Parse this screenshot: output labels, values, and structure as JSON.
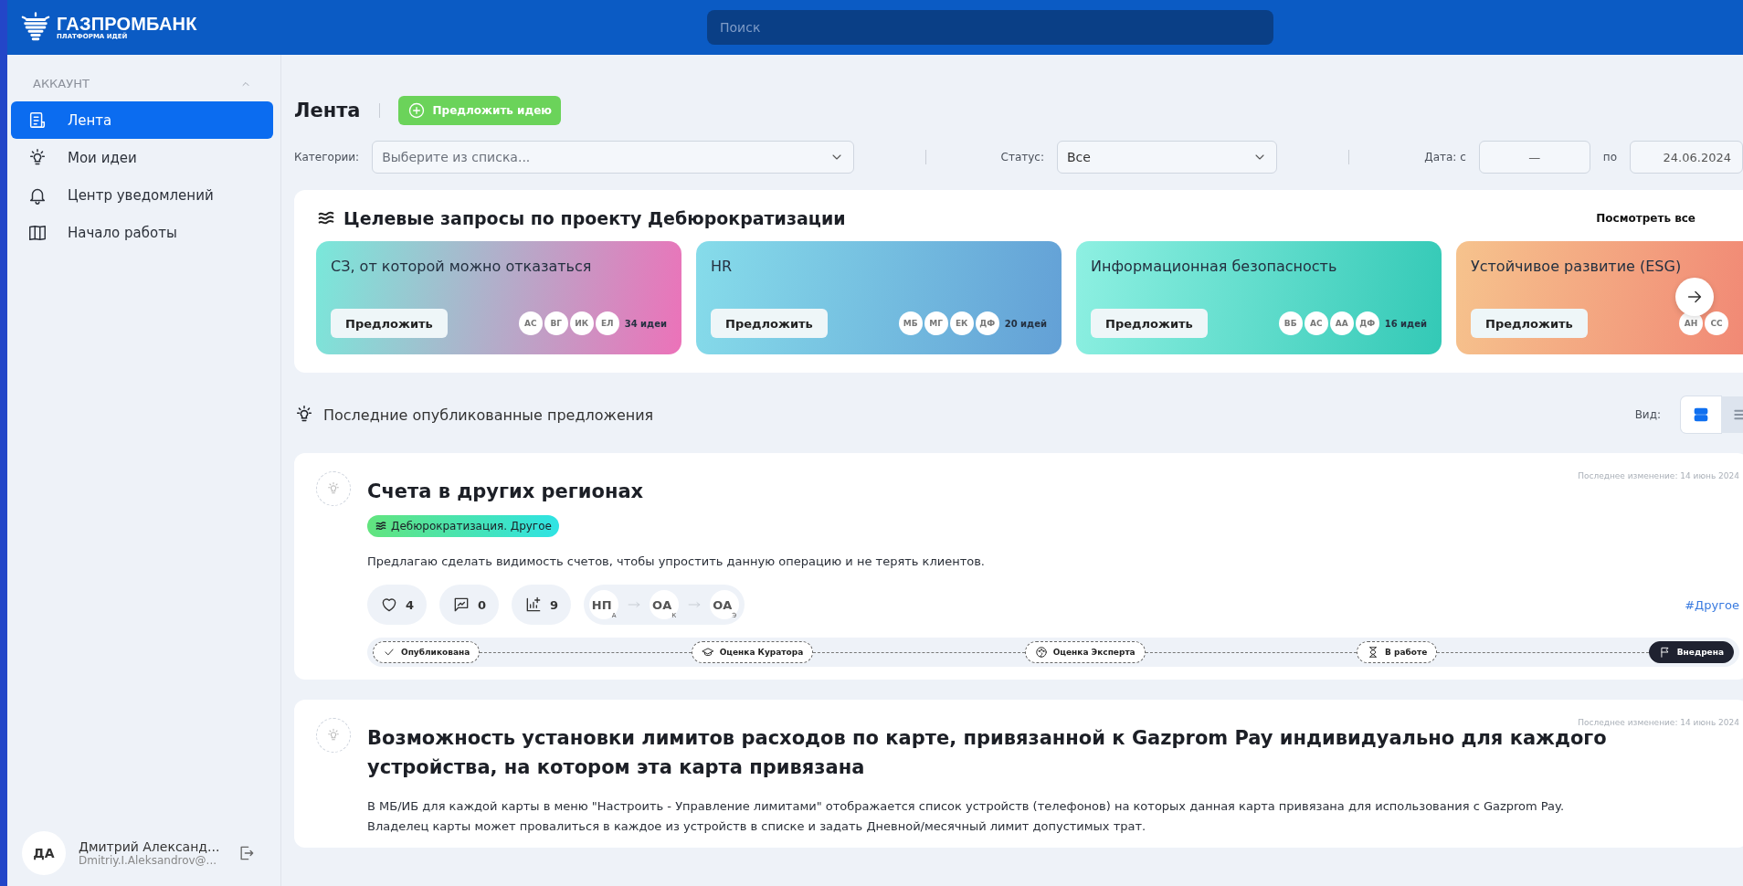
{
  "header": {
    "brand": "ГАЗПРОМБАНК",
    "subtitle": "ПЛАТФОРМА ИДЕЙ",
    "search": {
      "placeholder": "Поиск"
    }
  },
  "sidebar": {
    "section": "АККАУНТ",
    "expanded": true,
    "items": [
      {
        "label": "Лента",
        "selected": true
      },
      {
        "label": "Мои идеи",
        "selected": false
      },
      {
        "label": "Центр уведомлений",
        "selected": false
      },
      {
        "label": "Начало работы",
        "selected": false
      }
    ],
    "user": {
      "initials": "ДА",
      "name": "Дмитрий Александ...",
      "email": "Dmitriy.I.Aleksandrov@..."
    }
  },
  "page": {
    "title": "Лента",
    "propose_button": "Предложить идею",
    "filters": {
      "categories_label": "Категории:",
      "categories_placeholder": "Выберите из списка...",
      "status_label": "Статус:",
      "status_value": "Все",
      "date_label": "Дата: с",
      "date_from": "—",
      "date_to_label": "по",
      "date_to": "24.06.2024"
    }
  },
  "targets": {
    "title": "Целевые запросы по проекту Дебюрократизации",
    "view_all": "Посмотреть все",
    "cards": [
      {
        "title": "СЗ, от которой можно отказаться",
        "button": "Предложить",
        "avatars": [
          "АС",
          "ВГ",
          "ИК",
          "ЕЛ"
        ],
        "count": "34 идеи",
        "color": "#ec72b9"
      },
      {
        "title": "HR",
        "button": "Предложить",
        "avatars": [
          "МБ",
          "МГ",
          "ЕК",
          "ДФ"
        ],
        "count": "20 идей",
        "color": "#63a0d6"
      },
      {
        "title": "Информационная безопасность",
        "button": "Предложить",
        "avatars": [
          "ВБ",
          "АС",
          "АА",
          "ДФ"
        ],
        "count": "16 идей",
        "color": "#33c9b6"
      },
      {
        "title": "Устойчивое развитие (ESG)",
        "button": "Предложить",
        "avatars": [
          "АН",
          "СС"
        ],
        "color": "#f18975"
      }
    ]
  },
  "recent": {
    "title": "Последние опубликованные предложения",
    "view_label": "Вид:",
    "views": [
      {
        "kind": "cards",
        "selected": true
      },
      {
        "kind": "list",
        "selected": false
      }
    ]
  },
  "posts": [
    {
      "title": "Счета в других регионах",
      "date": "Последнее изменение: 14 июнь 2024",
      "tag": "Дебюрократизация. Другое",
      "text": [
        "Предлагаю сделать видимость счетов, чтобы упростить данную операцию и не терять клиентов."
      ],
      "likes": "4",
      "comments": "0",
      "votes": "9",
      "route": [
        {
          "initials": "НП",
          "role": "А"
        },
        {
          "initials": "ОА",
          "role": "К"
        },
        {
          "initials": "ОА",
          "role": "Э"
        }
      ],
      "hashtag": "#Другое",
      "stages": [
        {
          "label": "Опубликована",
          "current": false
        },
        {
          "label": "Оценка Куратора",
          "current": false
        },
        {
          "label": "Оценка Эксперта",
          "current": false
        },
        {
          "label": "В работе",
          "current": false
        },
        {
          "label": "Внедрена",
          "current": true
        }
      ]
    },
    {
      "title": "Возможность установки лимитов расходов по карте, привязанной к Gazprom Pay индивидуально для каждого устройства, на котором эта карта привязана",
      "date": "Последнее изменение: 14 июнь 2024",
      "text": [
        "В МБ/ИБ для каждой карты в меню \"Настроить - Управление лимитами\" отображается список устройств (телефонов) на которых данная карта привязана для использования с Gazprom Pay.",
        "Владелец карты может провалиться в каждое из устройств в списке и задать Дневной/месячный лимит допустимых трат."
      ]
    }
  ]
}
